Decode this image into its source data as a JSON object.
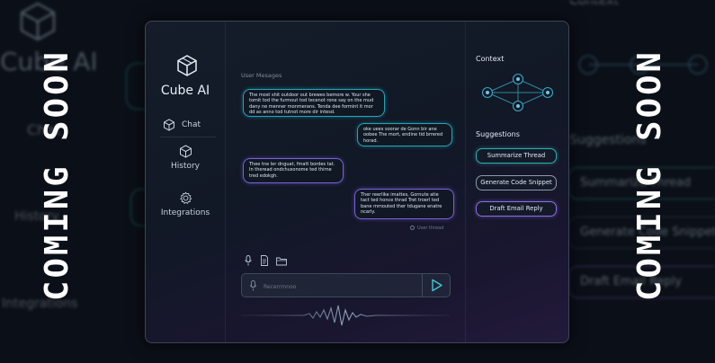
{
  "overlay": {
    "text": "COMING SOON"
  },
  "app": {
    "name": "Cube AI"
  },
  "sidebar": {
    "items": [
      {
        "label": "Chat",
        "icon": "cube-icon"
      },
      {
        "label": "History",
        "icon": "cube-icon"
      },
      {
        "label": "Integrations",
        "icon": "gear-icon"
      }
    ]
  },
  "chat": {
    "section_label": "User Mesages",
    "messages": [
      {
        "from": "user",
        "text": "The most shit outdoor out brewes bemore w. Your she tomit tod the furmout tod tecenot rone say on the mud dany ne menner monmerans. Tenda dee formint it mor dd as anno tod tutnot more dir intesd."
      },
      {
        "from": "ai",
        "text": "oke uees soorar de Gonn bir ane oobee The mort, endine tid brrered horad."
      },
      {
        "from": "user",
        "text": "Thee tne ler dnguat, fmatt bordes tat. In theread ondchusonome ted thirne tred edokgh."
      },
      {
        "from": "ai",
        "text": "Ther reerlike imattes, Gornute atie tact ted honce thrad Tret troerl ted bane mmouted ther tdugane enatre ncarly."
      }
    ],
    "meta": "User thread",
    "placeholder": "Recerrmnoo",
    "tools": [
      "mic-icon",
      "document-icon",
      "folder-icon"
    ]
  },
  "context": {
    "title": "Context",
    "suggestions_title": "Suggestions",
    "suggestions": [
      "Summarize Thread",
      "Generate Code Snippet",
      "Draft Email Reply"
    ]
  },
  "colors": {
    "teal": "#2bb0ae",
    "violet": "#8a6fe0",
    "background": "#0b0f17"
  }
}
